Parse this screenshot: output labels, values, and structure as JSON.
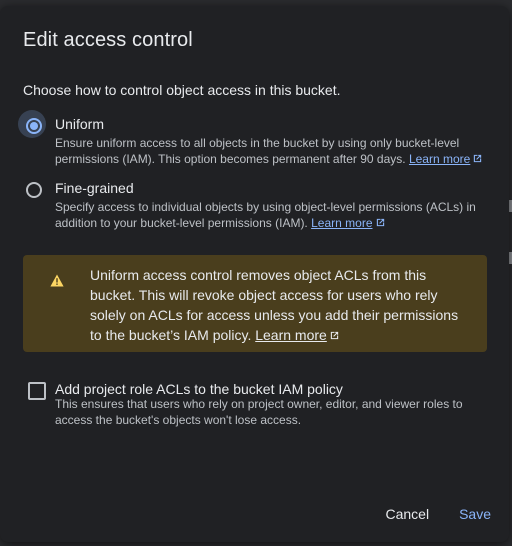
{
  "dialog": {
    "title": "Edit access control",
    "subtitle": "Choose how to control object access in this bucket."
  },
  "options": [
    {
      "label": "Uniform",
      "selected": true,
      "description": "Ensure uniform access to all objects in the bucket by using only bucket-level permissions (IAM). This option becomes permanent after 90 days.",
      "link": "Learn more"
    },
    {
      "label": "Fine-grained",
      "selected": false,
      "description": "Specify access to individual objects by using object-level permissions (ACLs) in addition to your bucket-level permissions (IAM).",
      "link": "Learn more"
    }
  ],
  "warning": {
    "icon": "warning-icon",
    "text": "Uniform access control removes object ACLs from this bucket. This will revoke object access for users who rely solely on ACLs for access unless you add their permissions to the bucket’s IAM policy.",
    "link": "Learn more"
  },
  "checkbox": {
    "checked": false,
    "label": "Add project role ACLs to the bucket IAM policy",
    "description": "This ensures that users who rely on project owner, editor, and viewer roles to access the bucket's objects won't lose access."
  },
  "actions": {
    "cancel": "Cancel",
    "save": "Save"
  },
  "colors": {
    "accent": "#8ab4f8",
    "warning_bg": "#4a3e1d",
    "warning_icon": "#fdd663",
    "dialog_bg": "#202124"
  }
}
